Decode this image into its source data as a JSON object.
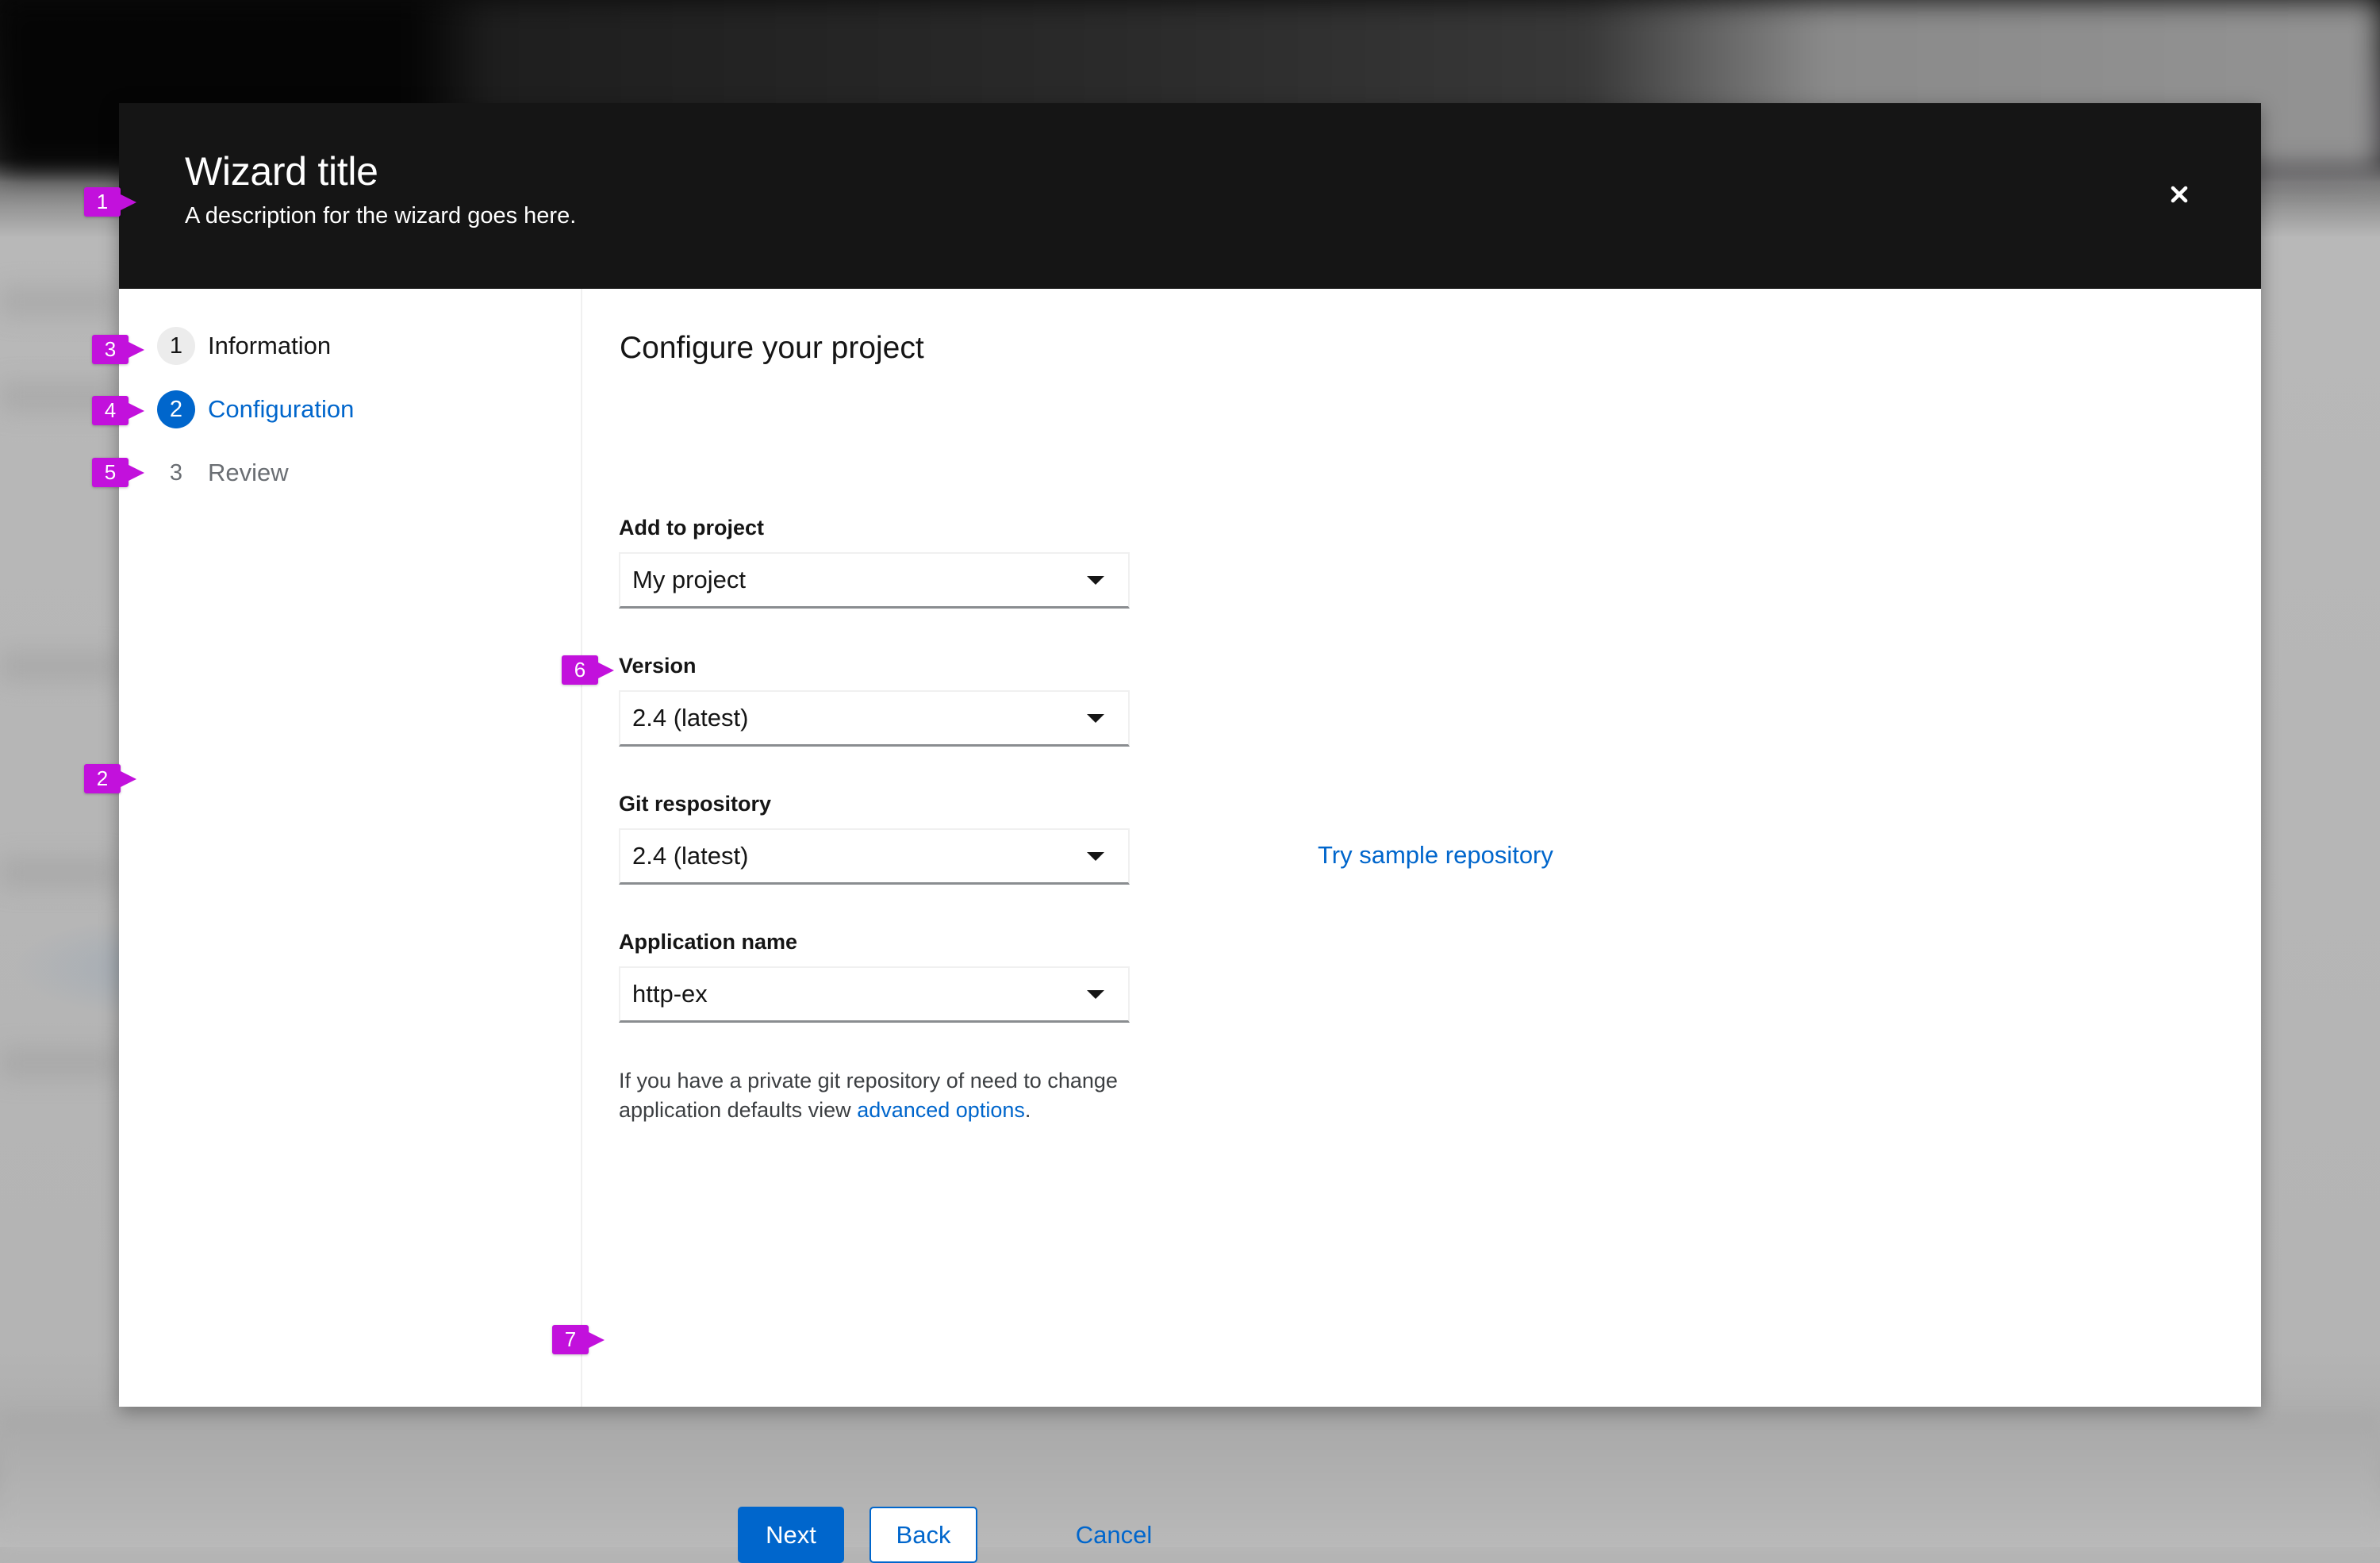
{
  "wizard": {
    "title": "Wizard title",
    "description": "A description for the wizard goes here.",
    "close_icon": "close-icon"
  },
  "nav": {
    "steps": [
      {
        "number": "1",
        "label": "Information",
        "state": "done"
      },
      {
        "number": "2",
        "label": "Configuration",
        "state": "current"
      },
      {
        "number": "3",
        "label": "Review",
        "state": "pending"
      }
    ]
  },
  "main": {
    "heading": "Configure your project",
    "fields": [
      {
        "label": "Add to project",
        "value": "My project"
      },
      {
        "label": "Version",
        "value": "2.4 (latest)"
      },
      {
        "label": "Git respository",
        "value": "2.4 (latest)"
      },
      {
        "label": "Application name",
        "value": "http-ex"
      }
    ],
    "try_sample_link": "Try sample repository",
    "helper_text_prefix": "If you have a private git repository of need to change application defaults view ",
    "helper_link": "advanced options",
    "helper_text_suffix": "."
  },
  "footer": {
    "next_label": "Next",
    "back_label": "Back",
    "cancel_label": "Cancel"
  },
  "annotations": [
    "1",
    "2",
    "3",
    "4",
    "5",
    "6",
    "7"
  ],
  "colors": {
    "accent": "#0066cc",
    "header_bg": "#151515",
    "annotation": "#c211dc",
    "step_done_bg": "#ececec",
    "muted_text": "#6a6e73"
  }
}
